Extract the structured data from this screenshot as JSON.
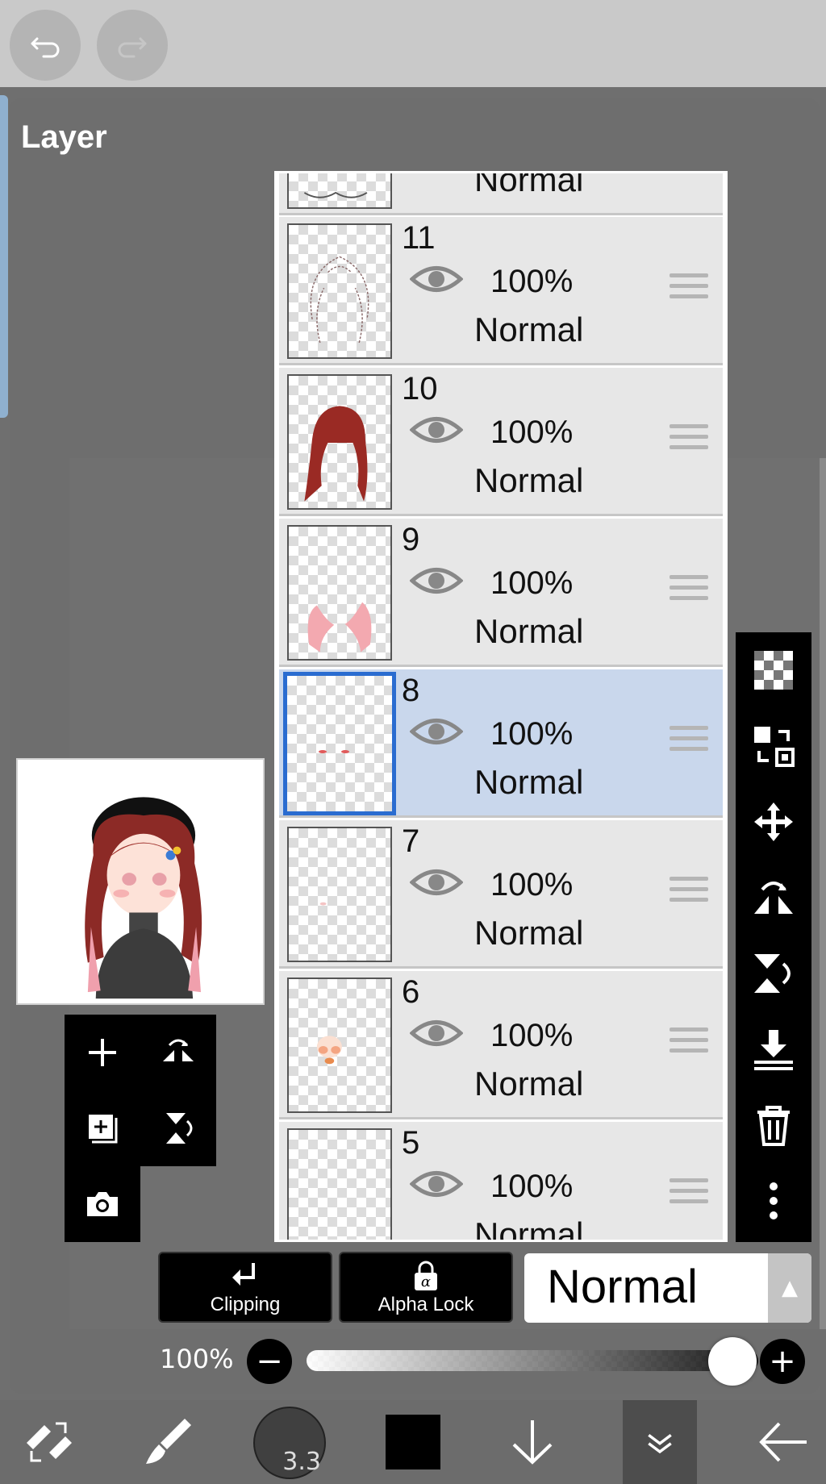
{
  "panel": {
    "title": "Layer"
  },
  "layers": [
    {
      "number": "",
      "opacity": "",
      "blend": "Normal"
    },
    {
      "number": "11",
      "opacity": "100%",
      "blend": "Normal"
    },
    {
      "number": "10",
      "opacity": "100%",
      "blend": "Normal"
    },
    {
      "number": "9",
      "opacity": "100%",
      "blend": "Normal"
    },
    {
      "number": "8",
      "opacity": "100%",
      "blend": "Normal",
      "selected": true
    },
    {
      "number": "7",
      "opacity": "100%",
      "blend": "Normal"
    },
    {
      "number": "6",
      "opacity": "100%",
      "blend": "Normal"
    },
    {
      "number": "5",
      "opacity": "100%",
      "blend": "Normal"
    }
  ],
  "bottom_controls": {
    "clipping_label": "Clipping",
    "alpha_lock_label": "Alpha Lock",
    "blend_mode": "Normal",
    "opacity_label": "100%",
    "opacity_value": 1.0
  },
  "toolbar": {
    "brush_size": "3.3",
    "current_color": "#000000"
  },
  "colors": {
    "selected_row": "#c9d7ec",
    "selected_border": "#2a6cd0",
    "panel_bg": "#6e6e6e"
  }
}
